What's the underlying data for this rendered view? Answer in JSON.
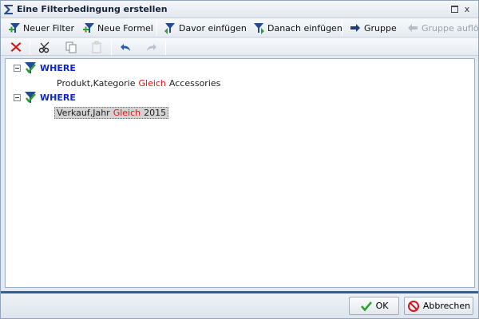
{
  "window": {
    "title": "Eine Filterbedingung erstellen",
    "maximize_icon": "maximize-icon",
    "close_glyph": "x"
  },
  "toolbar1": {
    "items": [
      {
        "label": "Neuer Filter",
        "icon": "filter-add-icon"
      },
      {
        "label": "Neue Formel",
        "icon": "formula-add-icon"
      },
      {
        "label": "Davor einfügen",
        "icon": "insert-before-icon"
      },
      {
        "label": "Danach einfügen",
        "icon": "insert-after-icon"
      },
      {
        "label": "Gruppe",
        "icon": "group-icon"
      },
      {
        "label": "Gruppe auflösen",
        "icon": "ungroup-icon",
        "disabled": true
      }
    ]
  },
  "toolbar2": {
    "items": [
      "delete-icon",
      "cut-icon",
      "copy-icon",
      "paste-icon",
      "undo-icon",
      "redo-icon"
    ]
  },
  "tree": {
    "groups": [
      {
        "keyword": "WHERE",
        "condition": {
          "field": "Produkt,Kategorie",
          "operator": "Gleich",
          "value": "Accessories"
        },
        "selected": false
      },
      {
        "keyword": "WHERE",
        "condition": {
          "field": "Verkauf,Jahr",
          "operator": "Gleich",
          "value": "2015"
        },
        "selected": true
      }
    ]
  },
  "footer": {
    "ok_label": "OK",
    "cancel_label": "Abbrechen"
  },
  "colors": {
    "keyword": "#0b29c9",
    "operator": "#e0141b",
    "footer_bar": "#2f5f98"
  }
}
